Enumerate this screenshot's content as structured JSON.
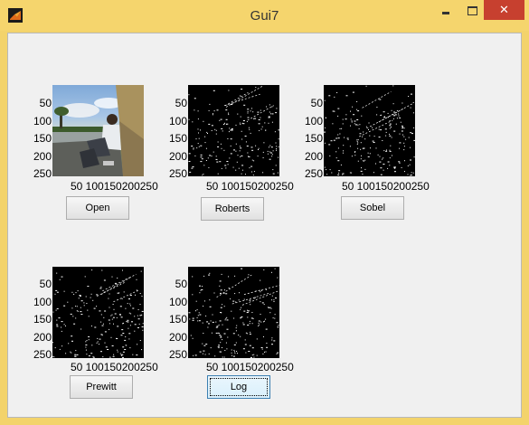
{
  "window": {
    "title": "Gui7",
    "close_glyph": "✕",
    "app_icon": "matlab-icon"
  },
  "axes_ticks": {
    "y": [
      "50",
      "100",
      "150",
      "200",
      "250"
    ],
    "x": "50 100150200250"
  },
  "panels": [
    {
      "id": "open",
      "button_label": "Open",
      "image": "photo"
    },
    {
      "id": "roberts",
      "button_label": "Roberts",
      "image": "edges"
    },
    {
      "id": "sobel",
      "button_label": "Sobel",
      "image": "edges"
    },
    {
      "id": "prewitt",
      "button_label": "Prewitt",
      "image": "edges"
    },
    {
      "id": "log",
      "button_label": "Log",
      "image": "edges",
      "focused": true
    }
  ]
}
